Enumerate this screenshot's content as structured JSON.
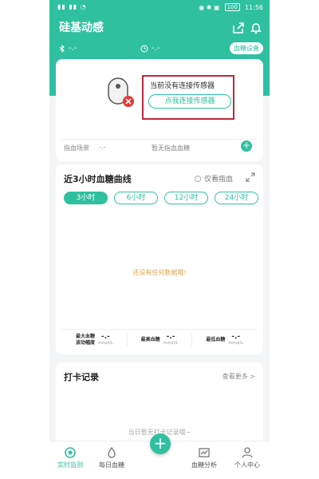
{
  "status_bar": {
    "left": "ии ии",
    "right_battery": "100",
    "time": "11:56"
  },
  "app": {
    "title": "硅基动感"
  },
  "device_row": {
    "bt_value": "-.-",
    "clock_value": "-.-",
    "device_button": "血糖设备"
  },
  "sensor_card": {
    "no_sensor": "当前没有连接传感器",
    "connect_button": "点我连接传感器",
    "scene_label": "指血场景",
    "scene_value": "-.-",
    "no_finger_glucose": "暂无指血血糖",
    "add_button": "+"
  },
  "curve_card": {
    "title": "近3小时血糖曲线",
    "finger_only": "仅看指血",
    "tabs": [
      {
        "label": "3小时",
        "active": true
      },
      {
        "label": "6小时",
        "active": false
      },
      {
        "label": "12小时",
        "active": false
      },
      {
        "label": "24小时",
        "active": false
      }
    ],
    "no_data": "还没有任何数据哦!",
    "stats": [
      {
        "label1": "最大血糖",
        "label2": "波动幅度",
        "value": "-.-",
        "unit": "mmol/L"
      },
      {
        "label1": "最高血糖",
        "label2": "",
        "value": "-.-",
        "unit": "mmol/L"
      },
      {
        "label1": "最低血糖",
        "label2": "",
        "value": "-.-",
        "unit": "mmol/L"
      }
    ]
  },
  "checkin_card": {
    "title": "打卡记录",
    "see_more": "查看更多 >",
    "empty": "当日暂无打卡记录哦~"
  },
  "bottom_nav": {
    "realtime": "实时监测",
    "daily": "每日血糖",
    "center": "+",
    "analysis": "血糖分析",
    "profile": "个人中心"
  },
  "colors": {
    "accent": "#2fc0a0",
    "highlight": "#c0283a"
  }
}
